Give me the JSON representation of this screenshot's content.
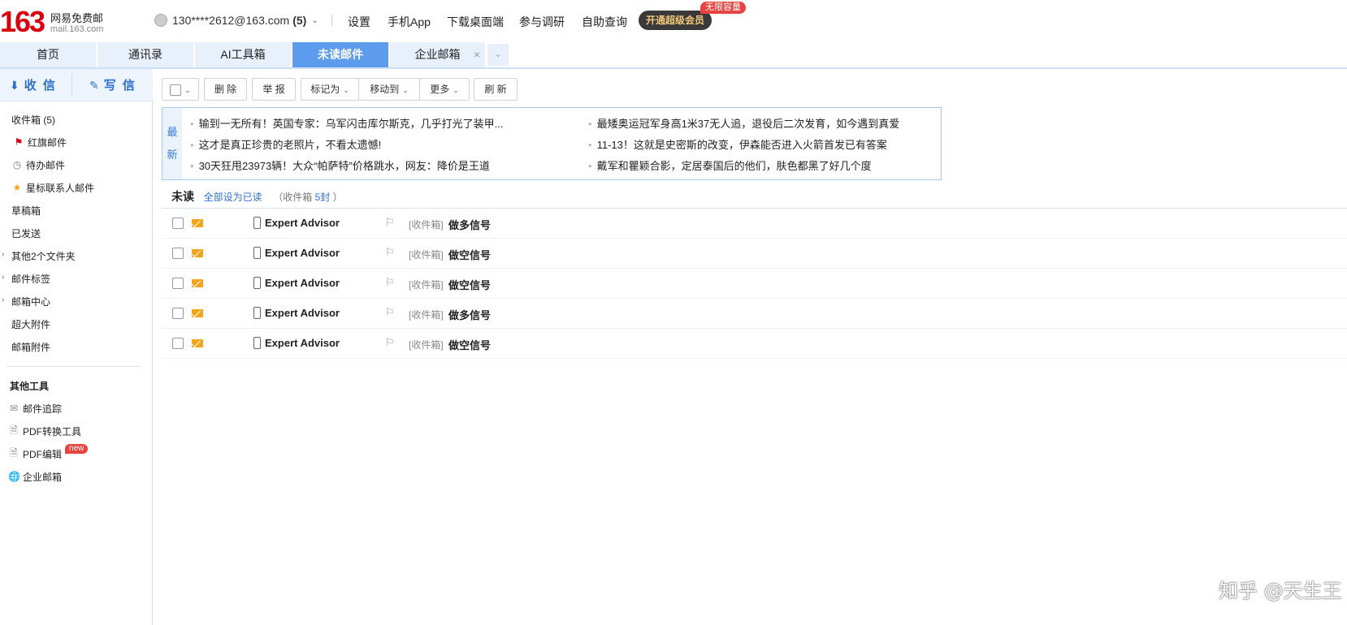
{
  "brand": {
    "number": "163",
    "title": "网易免费邮",
    "domain": "mail.163.com"
  },
  "account": {
    "email": "130****2612@163.com",
    "count": "(5)"
  },
  "top_links": [
    "设置",
    "手机App",
    "下载桌面端",
    "参与调研",
    "自助查询"
  ],
  "vip": {
    "label": "开通超级会员",
    "badge": "无限容量"
  },
  "tabs": [
    {
      "label": "首页"
    },
    {
      "label": "通讯录"
    },
    {
      "label": "AI工具箱"
    },
    {
      "label": "未读邮件"
    },
    {
      "label": "企业邮箱"
    }
  ],
  "sidebar": {
    "receive": "收 信",
    "compose": "写 信",
    "folders": [
      {
        "label": "收件箱 (5)"
      },
      {
        "label": "红旗邮件"
      },
      {
        "label": "待办邮件"
      },
      {
        "label": "星标联系人邮件"
      },
      {
        "label": "草稿箱"
      },
      {
        "label": "已发送"
      },
      {
        "label": "其他2个文件夹"
      },
      {
        "label": "邮件标签"
      },
      {
        "label": "邮箱中心"
      },
      {
        "label": "超大附件"
      },
      {
        "label": "邮箱附件"
      }
    ],
    "tools_title": "其他工具",
    "tools": [
      {
        "label": "邮件追踪"
      },
      {
        "label": "PDF转换工具"
      },
      {
        "label": "PDF编辑",
        "badge": "new"
      },
      {
        "label": "企业邮箱"
      }
    ]
  },
  "toolbar": {
    "delete": "删 除",
    "report": "举 报",
    "mark_as": "标记为",
    "move_to": "移动到",
    "more": "更多",
    "refresh": "刷 新"
  },
  "news": {
    "tag_1": "最",
    "tag_2": "新",
    "items": [
      "输到一无所有！英国专家：乌军闪击库尔斯克，几乎打光了装甲...",
      "最矮奥运冠军身高1米37无人追，退役后二次发育，如今遇到真爱",
      "这才是真正珍贵的老照片，不看太遗憾!",
      "11-13！这就是史密斯的改变，伊森能否进入火箭首发已有答案",
      "30天狂甩23973辆！大众“帕萨特”价格跳水，网友：降价是王道",
      "戴军和瞿颖合影，定居泰国后的他们，肤色都黑了好几个度"
    ]
  },
  "unread": {
    "title": "未读",
    "mark_all": "全部设为已读",
    "inbox_prefix": "（收件箱",
    "inbox_count": "5封",
    "inbox_suffix": "）"
  },
  "mails": [
    {
      "sender": "Expert Advisor",
      "folder": "[收件箱]",
      "subject": "做多信号"
    },
    {
      "sender": "Expert Advisor",
      "folder": "[收件箱]",
      "subject": "做空信号"
    },
    {
      "sender": "Expert Advisor",
      "folder": "[收件箱]",
      "subject": "做空信号"
    },
    {
      "sender": "Expert Advisor",
      "folder": "[收件箱]",
      "subject": "做多信号"
    },
    {
      "sender": "Expert Advisor",
      "folder": "[收件箱]",
      "subject": "做空信号"
    }
  ],
  "watermark": "知乎 @天生王"
}
